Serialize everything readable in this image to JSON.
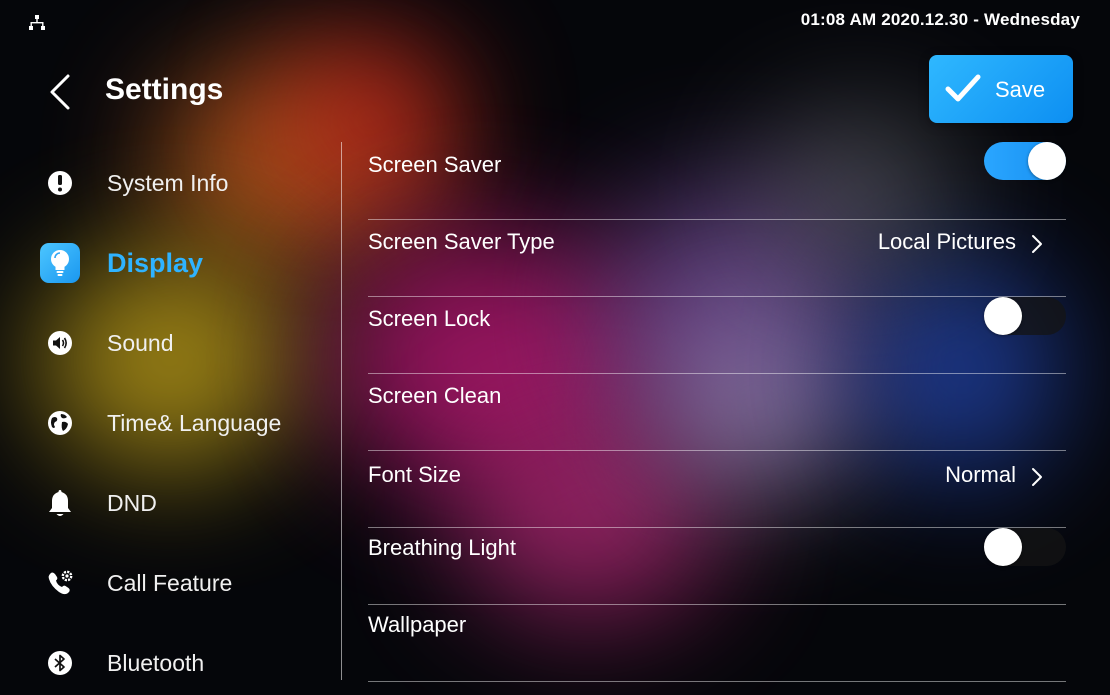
{
  "status_bar": {
    "datetime": "01:08 AM  2020.12.30 - Wednesday",
    "network_icon": "network-tree-icon"
  },
  "header": {
    "title": "Settings",
    "back_icon": "chevron-left-icon",
    "save_label": "Save",
    "save_icon": "checkmark-icon"
  },
  "sidebar": {
    "items": [
      {
        "label": "System Info",
        "icon": "info-exclamation-icon",
        "active": false
      },
      {
        "label": "Display",
        "icon": "lightbulb-icon",
        "active": true
      },
      {
        "label": "Sound",
        "icon": "speaker-icon",
        "active": false
      },
      {
        "label": "Time& Language",
        "icon": "globe-icon",
        "active": false
      },
      {
        "label": "DND",
        "icon": "bell-icon",
        "active": false
      },
      {
        "label": "Call Feature",
        "icon": "phone-gear-icon",
        "active": false
      },
      {
        "label": "Bluetooth",
        "icon": "bluetooth-icon",
        "active": false
      }
    ]
  },
  "settings": {
    "rows": [
      {
        "label": "Screen Saver",
        "control": "toggle",
        "on": true
      },
      {
        "label": "Screen Saver Type",
        "control": "select",
        "value": "Local Pictures"
      },
      {
        "label": "Screen Lock",
        "control": "toggle",
        "on": false
      },
      {
        "label": "Screen Clean",
        "control": "none"
      },
      {
        "label": "Font Size",
        "control": "select",
        "value": "Normal"
      },
      {
        "label": "Breathing Light",
        "control": "toggle",
        "on": false
      },
      {
        "label": "Wallpaper",
        "control": "none"
      }
    ]
  },
  "colors": {
    "accent": "#2FB3FF",
    "toggle_on": "#1E9BF5",
    "background": "#05060A"
  }
}
